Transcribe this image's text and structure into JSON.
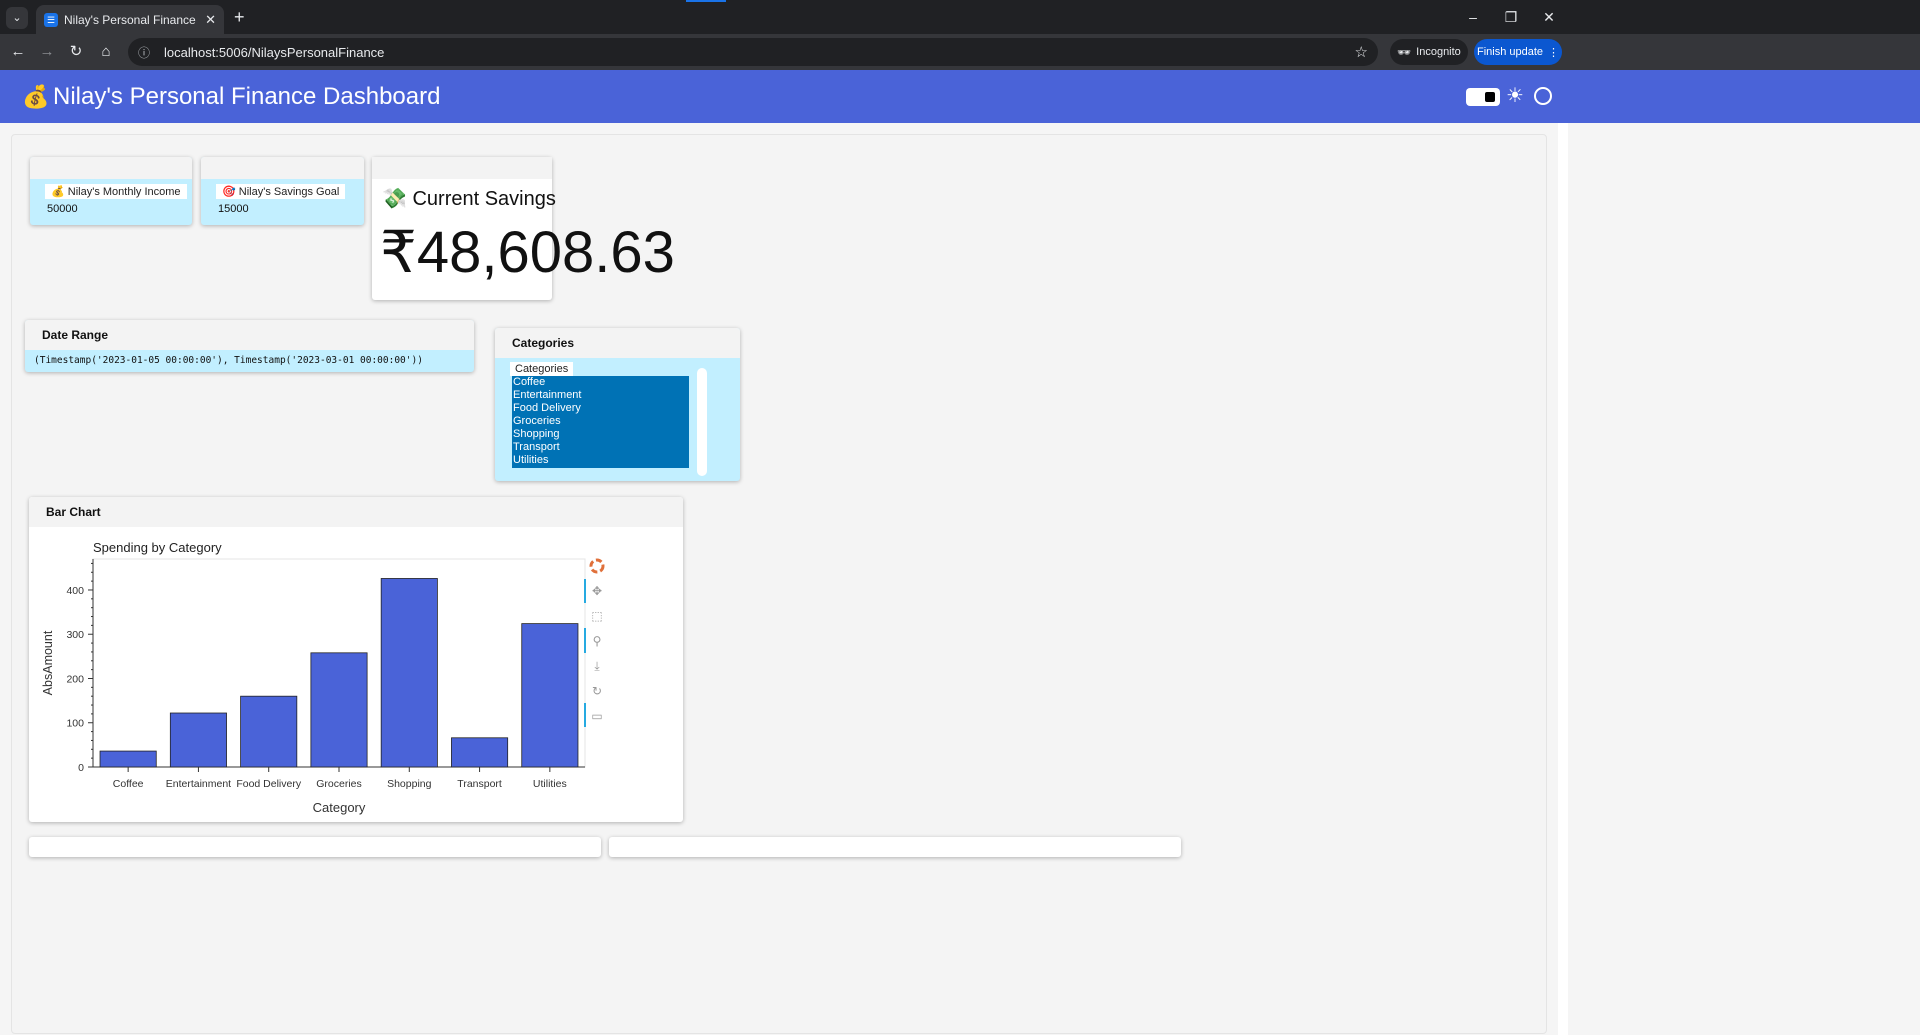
{
  "browser": {
    "tab_title": "Nilay's Personal Finance Das",
    "url": "localhost:5006/NilaysPersonalFinance",
    "incognito_label": "Incognito",
    "finish_update_label": "Finish update"
  },
  "app": {
    "title": "Nilay's Personal Finance Dashboard"
  },
  "widgets": {
    "income": {
      "label": "Nilay's Monthly Income",
      "value": "50000"
    },
    "savings_goal": {
      "label": "Nilay's Savings Goal",
      "value": "15000"
    },
    "current_savings": {
      "title": "Current Savings",
      "value": "₹48,608.63"
    }
  },
  "date_range": {
    "header": "Date Range",
    "value": "(Timestamp('2023-01-05 00:00:00'), Timestamp('2023-03-01 00:00:00'))"
  },
  "categories": {
    "header": "Categories",
    "label": "Categories",
    "options": [
      "Coffee",
      "Entertainment",
      "Food Delivery",
      "Groceries",
      "Shopping",
      "Transport",
      "Utilities"
    ]
  },
  "bar_chart_panel": {
    "header": "Bar Chart"
  },
  "colors": {
    "header": "#4a63d8",
    "bar": "#4a63d8",
    "card": "#c2efff",
    "select": "#0072b5"
  },
  "chart_data": {
    "type": "bar",
    "title": "Spending by Category",
    "xlabel": "Category",
    "ylabel": "AbsAmount",
    "categories": [
      "Coffee",
      "Entertainment",
      "Food Delivery",
      "Groceries",
      "Shopping",
      "Transport",
      "Utilities"
    ],
    "values": [
      36,
      122,
      160,
      258,
      426,
      66,
      324
    ],
    "ylim": [
      0,
      470
    ],
    "yticks": [
      0,
      100,
      200,
      300,
      400
    ],
    "grid": false,
    "legend": "none"
  }
}
